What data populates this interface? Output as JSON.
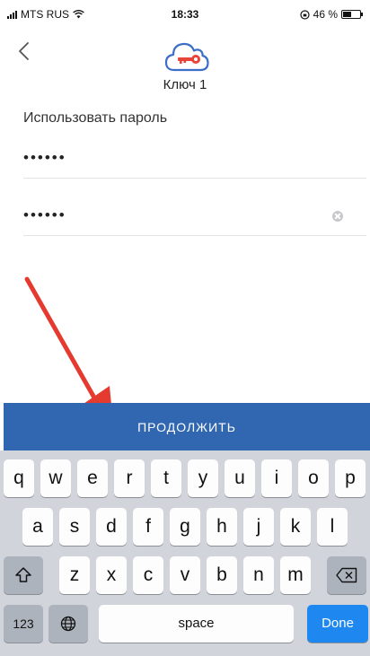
{
  "status_bar": {
    "carrier": "MTS RUS",
    "time": "18:33",
    "battery": "46 %"
  },
  "header": {
    "key_name": "Ключ 1"
  },
  "form": {
    "use_password_label": "Использовать пароль",
    "password_value": "••••••",
    "confirm_value": "••••••"
  },
  "continue_label": "ПРОДОЛЖИТЬ",
  "keyboard": {
    "row1": [
      "q",
      "w",
      "e",
      "r",
      "t",
      "y",
      "u",
      "i",
      "o",
      "p"
    ],
    "row2": [
      "a",
      "s",
      "d",
      "f",
      "g",
      "h",
      "j",
      "k",
      "l"
    ],
    "row3": [
      "z",
      "x",
      "c",
      "v",
      "b",
      "n",
      "m"
    ],
    "numbers_label": "123",
    "space_label": "space",
    "done_label": "Done"
  },
  "colors": {
    "accent": "#3067b0",
    "arrow": "#e53a2f",
    "done": "#1e88f0",
    "cloud": "#3a6ec8",
    "key": "#e8443a"
  }
}
